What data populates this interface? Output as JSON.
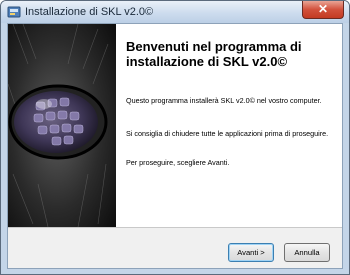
{
  "window": {
    "title": "Installazione di SKL v2.0©",
    "close_glyph": "✕"
  },
  "wizard": {
    "heading": "Benvenuti nel programma di installazione di SKL v2.0©",
    "paragraphs": [
      "Questo programma installerà SKL v2.0© nel vostro computer.",
      "Si consiglia di chiudere tutte le applicazioni prima di proseguire.",
      "Per proseguire, scegliere Avanti."
    ]
  },
  "buttons": {
    "next_label": "Avanti >",
    "cancel_label": "Annulla"
  },
  "icons": {
    "app": "installer-icon",
    "close": "close-icon"
  },
  "colors": {
    "titlebar": "#cddcee",
    "close_button": "#c33a22",
    "default_button_border": "#3c7fb1"
  }
}
